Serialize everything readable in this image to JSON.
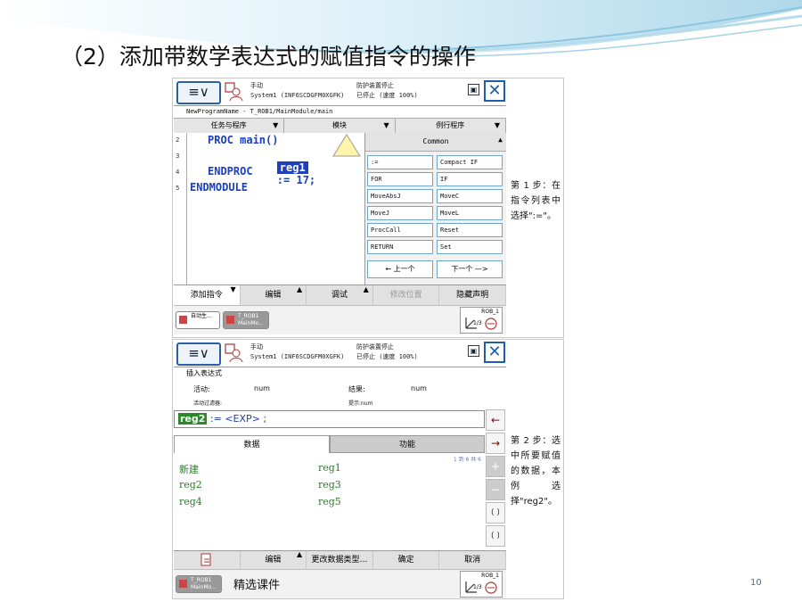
{
  "slide": {
    "title": "（2）添加带数学表达式的赋值指令的操作",
    "footer": "精选课件",
    "page_number": "10"
  },
  "screen1": {
    "header": {
      "menu_label": "≡∨",
      "status_line1": "手动",
      "status_line2": "System1 (INF6SCDGFM0XGFK)",
      "status_right1": "防护装置停止",
      "status_right2": "已停止 (速度 100%)"
    },
    "path": "NewProgramName - T_ROB1/MainModule/main",
    "tabs": [
      "任务与程序",
      "模块",
      "例行程序"
    ],
    "code": {
      "line_numbers": [
        "2",
        "3",
        "4",
        "5"
      ],
      "line2": "PROC main()",
      "line3_selected": "reg1",
      "line3_rest": ":= 17;",
      "line4": "ENDPROC",
      "line5": "ENDMODULE"
    },
    "panel": {
      "header": "Common",
      "instructions": [
        ":=",
        "Compact IF",
        "FOR",
        "IF",
        "MoveAbsJ",
        "MoveC",
        "MoveJ",
        "MoveL",
        "ProcCall",
        "Reset",
        "RETURN",
        "Set"
      ],
      "prev_label": "←  上一个",
      "next_label": "下一个 —>"
    },
    "bottom_menu": [
      "添加指令",
      "编辑",
      "调试",
      "修改位置",
      "隐藏声明"
    ],
    "taskbar": {
      "task1": "自动生...",
      "task2_line1": "T_ROB1",
      "task2_line2": "MainMo...",
      "rob_label": "ROB_1",
      "rob_value": "1/3"
    }
  },
  "caption1": "第 1 步：在指令列表中选择\":=\"。",
  "screen2": {
    "header": {
      "menu_label": "≡∨",
      "status_line1": "手动",
      "status_line2": "System1 (INF6SCDGFM0XGFK)",
      "status_right1": "防护装置停止",
      "status_right2": "已停止 (速度 100%)"
    },
    "title": "插入表达式",
    "active_label": "活动:",
    "active_value": "num",
    "result_label": "结果:",
    "result_value": "num",
    "filter_label": "活动过滤器:",
    "hint_label": "提示:num",
    "expr_token": "reg2",
    "expr_rest": ":= <EXP> ;",
    "tab_data": "数据",
    "tab_func": "功能",
    "page_info": "1 到 6 共 6",
    "data_items": [
      "新建",
      "reg1",
      "reg2",
      "reg3",
      "reg4",
      "reg5"
    ],
    "side_buttons": [
      "←",
      "→",
      "+",
      "−",
      "( )",
      "( )"
    ],
    "bottom_menu": [
      "编辑",
      "更改数据类型…",
      "确定",
      "取消"
    ],
    "taskbar": {
      "task1_line1": "T_ROB1",
      "task1_line2": "MainMo...",
      "rob_label": "ROB_1",
      "rob_value": "1/3"
    }
  },
  "caption2": "第 2 步：选中所要赋值的数据，本例选择\"reg2\"。",
  "colors": {
    "accent_blue": "#1d5fa8",
    "code_blue": "#1a3fbf",
    "data_green": "#2b7a2b"
  }
}
